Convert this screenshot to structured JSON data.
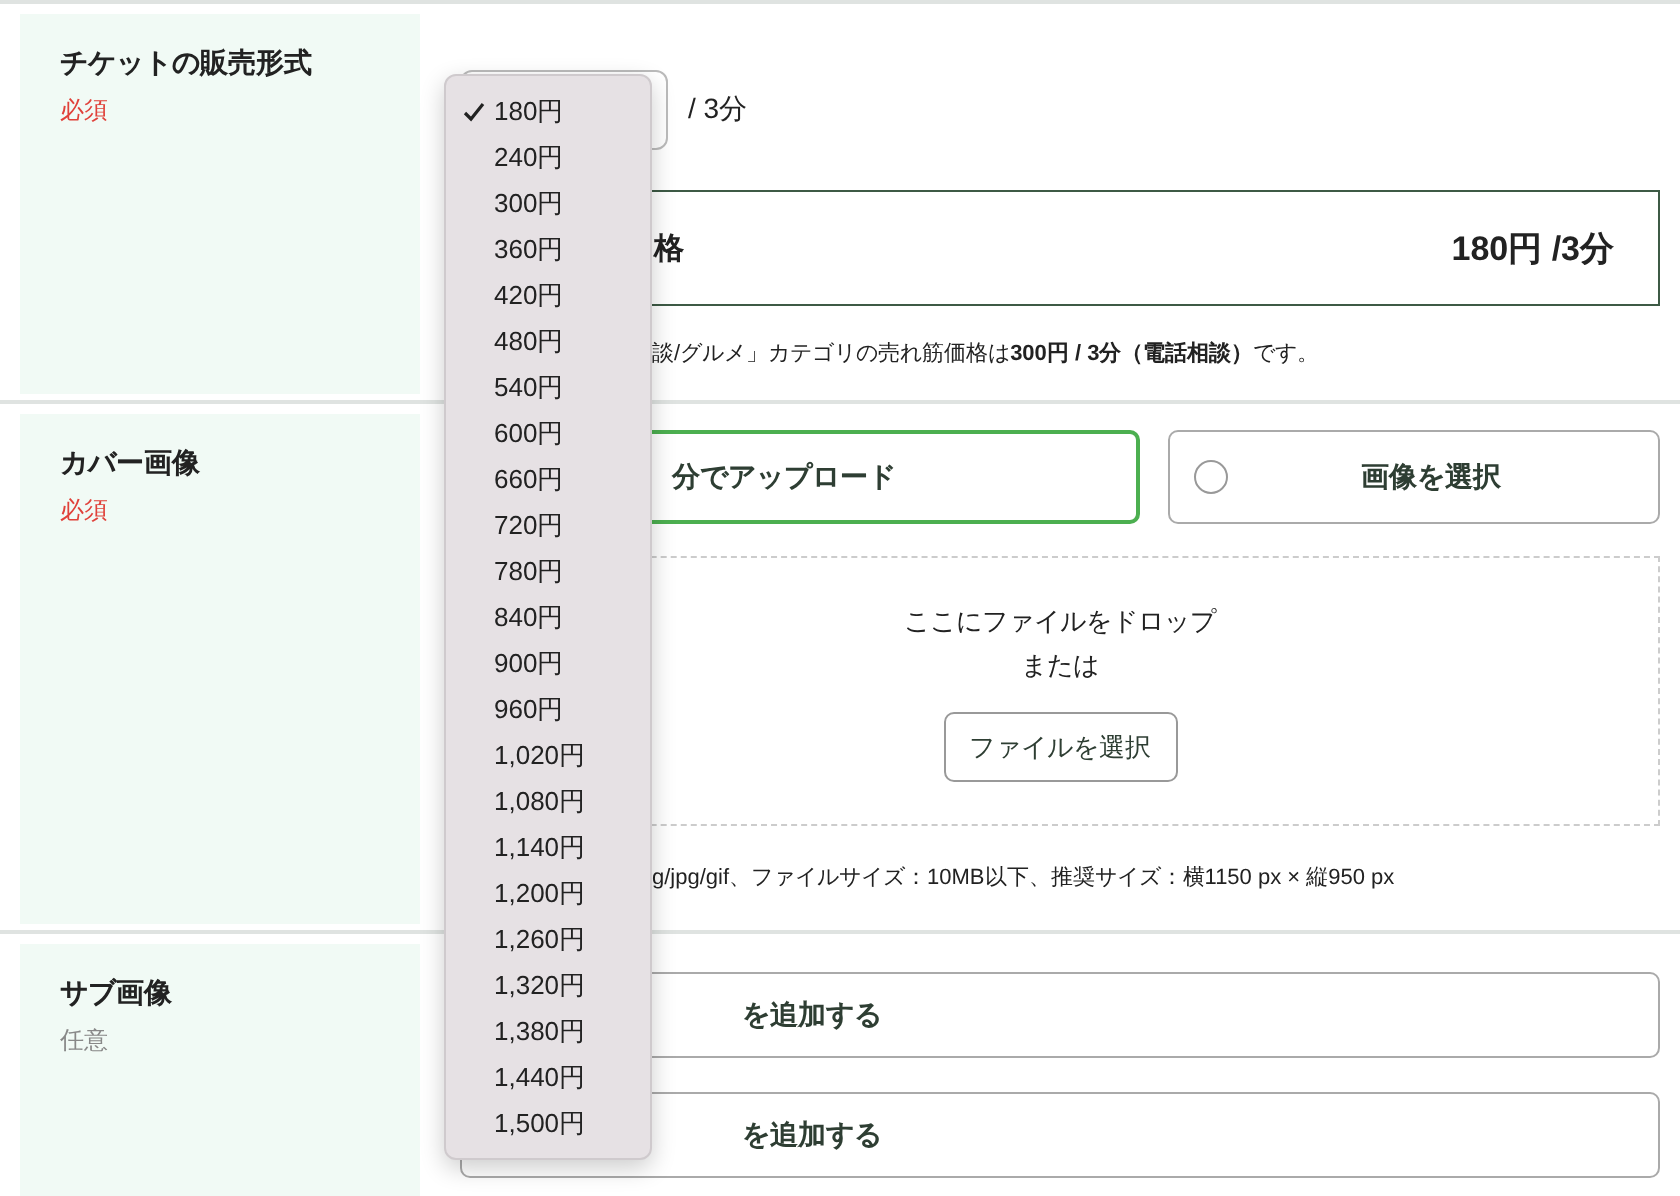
{
  "ticket_format": {
    "label": "チケットの販売形式",
    "requirement": "必須",
    "required": true,
    "unit": "/ 3分",
    "price_box": {
      "label": "格",
      "price": "180円 /3分"
    },
    "note": "談/グルメ」カテゴリの売れ筋価格は**300円 / 3分（電話相談）**です。"
  },
  "cover_image": {
    "label": "カバー画像",
    "requirement": "必須",
    "required": true,
    "options": [
      {
        "label": "分でアップロード",
        "selected": true
      },
      {
        "label": "画像を選択",
        "selected": false
      }
    ],
    "dropzone": {
      "lines": [
        "ここにファイルをドロップ",
        "または"
      ],
      "button": "ファイルを選択"
    },
    "note": "g/jpg/gif、ファイルサイズ：10MB以下、推奨サイズ：横1150 px × 縦950 px"
  },
  "sub_image": {
    "label": "サブ画像",
    "requirement": "任意",
    "required": false,
    "buttons": [
      "を追加する",
      "を追加する"
    ]
  },
  "price_dropdown": [
    {
      "label": "180円",
      "selected": true
    },
    {
      "label": "240円",
      "selected": false
    },
    {
      "label": "300円",
      "selected": false
    },
    {
      "label": "360円",
      "selected": false
    },
    {
      "label": "420円",
      "selected": false
    },
    {
      "label": "480円",
      "selected": false
    },
    {
      "label": "540円",
      "selected": false
    },
    {
      "label": "600円",
      "selected": false
    },
    {
      "label": "660円",
      "selected": false
    },
    {
      "label": "720円",
      "selected": false
    },
    {
      "label": "780円",
      "selected": false
    },
    {
      "label": "840円",
      "selected": false
    },
    {
      "label": "900円",
      "selected": false
    },
    {
      "label": "960円",
      "selected": false
    },
    {
      "label": "1,020円",
      "selected": false
    },
    {
      "label": "1,080円",
      "selected": false
    },
    {
      "label": "1,140円",
      "selected": false
    },
    {
      "label": "1,200円",
      "selected": false
    },
    {
      "label": "1,260円",
      "selected": false
    },
    {
      "label": "1,320円",
      "selected": false
    },
    {
      "label": "1,380円",
      "selected": false
    },
    {
      "label": "1,440円",
      "selected": false
    },
    {
      "label": "1,500円",
      "selected": false
    }
  ]
}
